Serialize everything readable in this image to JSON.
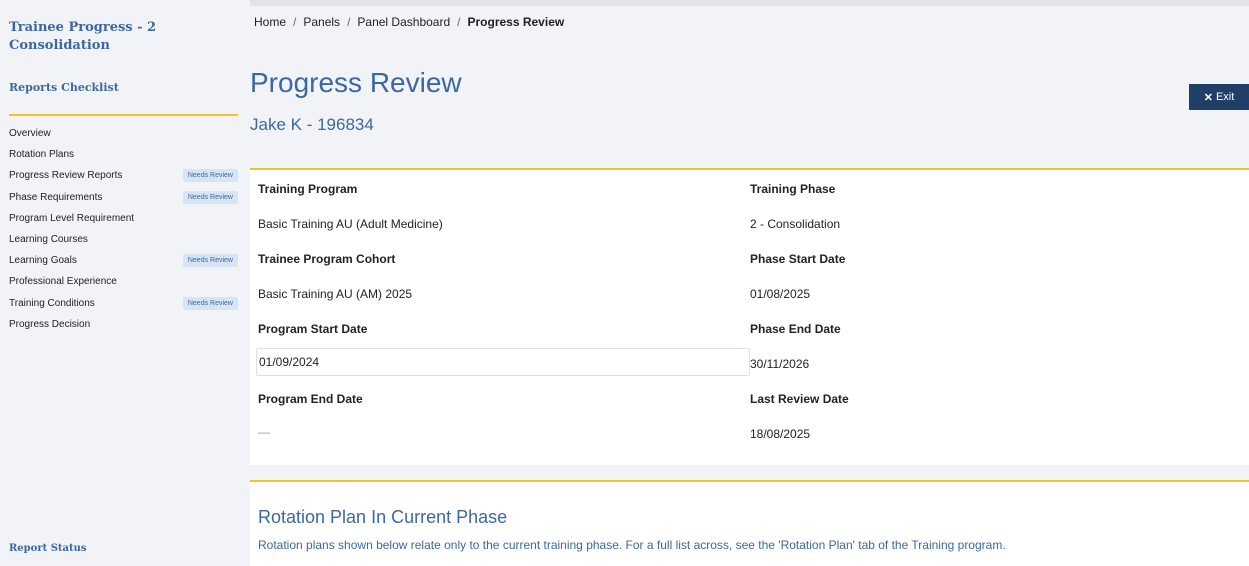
{
  "sidebar": {
    "title": "Trainee Progress - 2 Consolidation",
    "checklist_heading": "Reports Checklist",
    "items": [
      {
        "label": "Overview",
        "badge": ""
      },
      {
        "label": "Rotation Plans",
        "badge": ""
      },
      {
        "label": "Progress Review Reports",
        "badge": "Needs Review"
      },
      {
        "label": "Phase Requirements",
        "badge": "Needs Review"
      },
      {
        "label": "Program Level Requirement",
        "badge": ""
      },
      {
        "label": "Learning Courses",
        "badge": ""
      },
      {
        "label": "Learning Goals",
        "badge": "Needs Review"
      },
      {
        "label": "Professional Experience",
        "badge": ""
      },
      {
        "label": "Training Conditions",
        "badge": "Needs Review"
      },
      {
        "label": "Progress Decision",
        "badge": ""
      }
    ],
    "report_status": "Report Status"
  },
  "breadcrumb": {
    "home": "Home",
    "panels": "Panels",
    "panel_dashboard": "Panel Dashboard",
    "current": "Progress Review",
    "separator": "/"
  },
  "header": {
    "title": "Progress Review",
    "subtitle": "Jake K - 196834",
    "exit_icon": "✕",
    "exit_label": "Exit"
  },
  "details": {
    "training_program_label": "Training Program",
    "training_program_value": "Basic Training AU (Adult Medicine)",
    "training_phase_label": "Training Phase",
    "training_phase_value": "2 - Consolidation",
    "cohort_label": "Trainee Program Cohort",
    "cohort_value": "Basic Training AU (AM) 2025",
    "phase_start_label": "Phase Start Date",
    "phase_start_value": "01/08/2025",
    "program_start_label": "Program Start Date",
    "program_start_value": "01/09/2024",
    "phase_end_label": "Phase End Date",
    "phase_end_value": "30/11/2026",
    "program_end_label": "Program End Date",
    "program_end_value": "—",
    "last_review_label": "Last Review Date",
    "last_review_value": "18/08/2025"
  },
  "rotation": {
    "title": "Rotation Plan In Current Phase",
    "description": "Rotation plans shown below relate only to the current training phase. For a full list across, see the 'Rotation Plan' tab of the Training program."
  },
  "colors": {
    "accent": "#3b68a3",
    "gold": "#f2c12e",
    "exit_button": "#1f3f67",
    "badge_bg": "#d7e4f3",
    "panel_bg": "#f1f3f6"
  }
}
